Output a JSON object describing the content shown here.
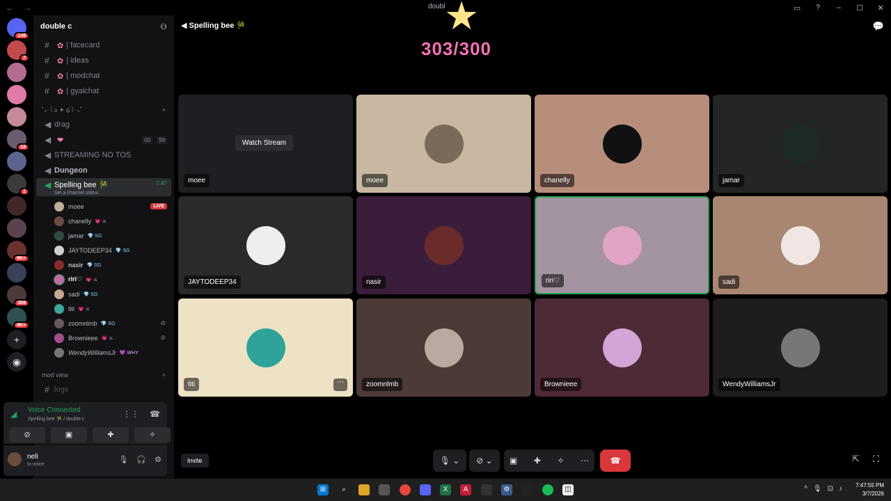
{
  "titlebar": {
    "title": "doubl",
    "back": "←",
    "forward": "→",
    "inbox_icon": "inbox-icon",
    "help_icon": "?",
    "min": "–",
    "max": "☐",
    "close": "✕"
  },
  "servers": {
    "dm_badge": "149",
    "badges": [
      "7",
      "",
      "",
      "",
      "18",
      "",
      "1",
      "",
      "",
      "9K+",
      "",
      "369",
      "4K+"
    ]
  },
  "sidebar": {
    "server_name": "double c",
    "channels": [
      "| facecard",
      "| ideas",
      "| modchat",
      "| gyalchat"
    ],
    "category_voice": "˚₊‧꒰ა ✦ ໒꒱‧₊˚",
    "voice_channels": [
      "drag",
      "",
      "STREAMING NO TOS",
      "Dungeon"
    ],
    "vc_counter": [
      "00",
      "99"
    ],
    "active_channel": "Spelling bee 🎋",
    "active_time": "7:47",
    "channel_status": "Set a channel status",
    "members": [
      {
        "name": "moee",
        "tag": "",
        "live": "LIVE"
      },
      {
        "name": "chanelly",
        "tag": "💗 ⚔"
      },
      {
        "name": "jamar",
        "tag": "💎 SG"
      },
      {
        "name": "JAYTODEEP34",
        "tag": "💎 SG"
      },
      {
        "name": "nasir",
        "tag": "💎 SG"
      },
      {
        "name": "riri♡",
        "tag": "💗 ⚔"
      },
      {
        "name": "sadi",
        "tag": "💎 SG"
      },
      {
        "name": "titi",
        "tag": "💗 ⚔"
      },
      {
        "name": "zoomnlmb",
        "tag": "💎 SG"
      },
      {
        "name": "Brownieee",
        "tag": "💗 ⚔"
      },
      {
        "name": "WendyWilliamsJr",
        "tag": "💜 WHY"
      }
    ],
    "mod_view": "mod view",
    "logs": "logs"
  },
  "voice": {
    "connected": "Voice Connected",
    "sub": "Spelling bee 🎋 / double c"
  },
  "user": {
    "name": "neli",
    "status": "In voice"
  },
  "main": {
    "title": "Spelling bee 🎋",
    "counter": "303/300"
  },
  "tiles": [
    {
      "label": "moee",
      "watch": "Watch Stream",
      "bg": "#1e1f22"
    },
    {
      "label": "moee",
      "bg": "#c8b8a2"
    },
    {
      "label": "chanelly",
      "bg": "#b78d7b"
    },
    {
      "label": "jamar",
      "bg": "#232624"
    },
    {
      "label": "JAYTODEEP34",
      "bg": "#2a2a2c"
    },
    {
      "label": "nasir",
      "bg": "#3a1d3a"
    },
    {
      "label": "riri♡",
      "bg": "#a493a0"
    },
    {
      "label": "sadi",
      "bg": "#a88672"
    },
    {
      "label": "titi",
      "bg": "#ede2c4"
    },
    {
      "label": "zoomnlmb",
      "bg": "#4b3a36"
    },
    {
      "label": "Brownieee",
      "bg": "#4d2a36"
    },
    {
      "label": "WendyWilliamsJr",
      "bg": "#1e1c1c"
    }
  ],
  "bottom": {
    "invite": "Invite"
  },
  "taskbar": {
    "time": "7:47:55 PM",
    "date": "3/7/2026"
  }
}
